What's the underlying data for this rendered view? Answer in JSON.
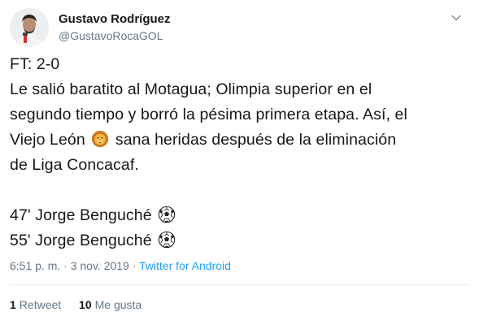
{
  "author": {
    "display_name": "Gustavo Rodríguez",
    "handle": "@GustavoRocaGOL",
    "avatar_icon": "profile-photo"
  },
  "tweet": {
    "lines": [
      "FT: 2-0",
      "Le salió baratito al Motagua; Olimpia superior en el",
      "segundo tiempo y borró la pésima primera etapa. Así, el",
      "Viejo León",
      "sana heridas después de la eliminación",
      "de Liga Concacaf."
    ],
    "goals": [
      "47' Jorge Benguché",
      "55' Jorge Benguché"
    ],
    "emoji": {
      "lion": "lion-face-icon",
      "ball": "soccer-ball-icon"
    }
  },
  "meta": {
    "time_date": "6:51 p. m. · 3 nov. 2019 · ",
    "source": "Twitter for Android"
  },
  "stats": {
    "retweets_count": "1",
    "retweets_label": "Retweet",
    "likes_count": "10",
    "likes_label": "Me gusta"
  },
  "colors": {
    "text": "#14171a",
    "secondary": "#657786",
    "link": "#1da1f2",
    "divider": "#e6ecf0"
  }
}
